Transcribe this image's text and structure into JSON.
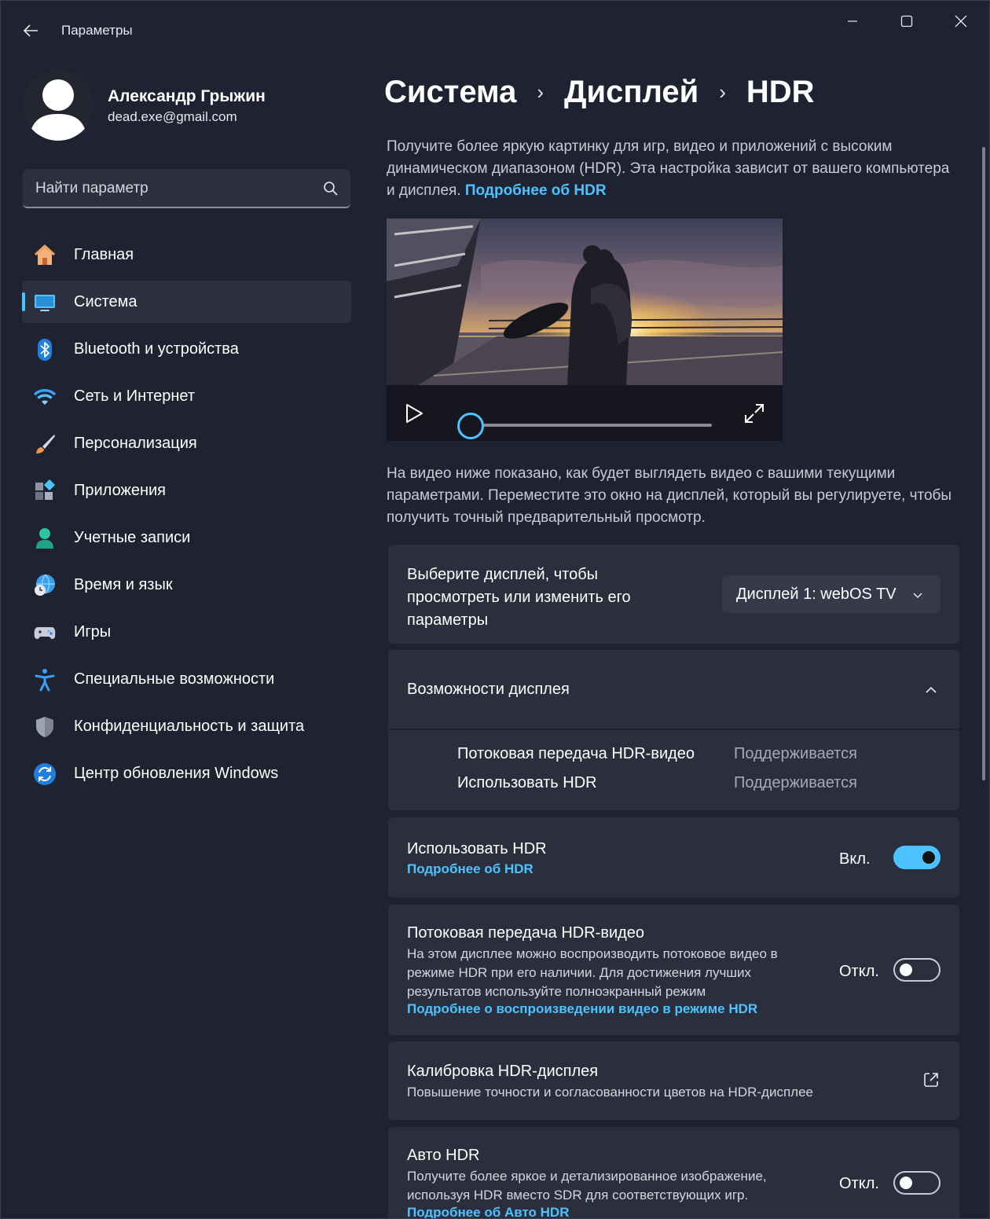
{
  "window": {
    "title": "Параметры"
  },
  "profile": {
    "name": "Александр Грыжин",
    "email": "dead.exe@gmail.com"
  },
  "search": {
    "placeholder": "Найти параметр"
  },
  "sidebar": {
    "items": [
      {
        "label": "Главная",
        "icon": "home-icon"
      },
      {
        "label": "Система",
        "icon": "system-display-icon",
        "active": true
      },
      {
        "label": "Bluetooth и устройства",
        "icon": "bluetooth-icon"
      },
      {
        "label": "Сеть и Интернет",
        "icon": "wifi-icon"
      },
      {
        "label": "Персонализация",
        "icon": "brush-icon"
      },
      {
        "label": "Приложения",
        "icon": "apps-icon"
      },
      {
        "label": "Учетные записи",
        "icon": "account-icon"
      },
      {
        "label": "Время и язык",
        "icon": "globe-clock-icon"
      },
      {
        "label": "Игры",
        "icon": "gamepad-icon"
      },
      {
        "label": "Специальные возможности",
        "icon": "accessibility-icon"
      },
      {
        "label": "Конфиденциальность и защита",
        "icon": "shield-icon"
      },
      {
        "label": "Центр обновления Windows",
        "icon": "update-icon"
      }
    ]
  },
  "breadcrumb": {
    "items": [
      "Система",
      "Дисплей",
      "HDR"
    ]
  },
  "intro": {
    "text": "Получите более яркую картинку для игр, видео и приложений с высоким динамическом диапазоном (HDR). Эта настройка зависит от вашего компьютера и дисплея.",
    "link": "Подробнее об HDR"
  },
  "video": {
    "progress": 0
  },
  "preview_note": "На видео ниже показано, как будет выглядеть видео с вашими текущими параметрами. Переместите это окно на дисплей, который вы регулируете, чтобы получить точный предварительный просмотр.",
  "display_select": {
    "label": "Выберите дисплей, чтобы просмотреть или изменить его параметры",
    "value": "Дисплей 1: webOS TV"
  },
  "capabilities": {
    "title": "Возможности дисплея",
    "rows": [
      {
        "label": "Потоковая передача HDR-видео",
        "value": "Поддерживается"
      },
      {
        "label": "Использовать HDR",
        "value": "Поддерживается"
      }
    ]
  },
  "use_hdr": {
    "title": "Использовать HDR",
    "link": "Подробнее об HDR",
    "state": "Вкл.",
    "on": true
  },
  "hdr_video": {
    "title": "Потоковая передача HDR-видео",
    "description": "На этом дисплее можно воспроизводить потоковое видео в режиме HDR при его наличии. Для достижения лучших результатов используйте полноэкранный режим",
    "link": "Подробнее о воспроизведении видео в режиме HDR",
    "state": "Откл.",
    "on": false
  },
  "calibration": {
    "title": "Калибровка HDR-дисплея",
    "description": "Повышение точности и согласованности цветов на HDR-дисплее"
  },
  "auto_hdr": {
    "title": "Авто HDR",
    "description": "Получите более яркое и детализированное изображение, используя HDR вместо SDR для соответствующих игр.",
    "link": "Подробнее об Авто HDR",
    "state": "Откл.",
    "on": false
  },
  "colors": {
    "accent": "#4cc2ff",
    "background": "#1f2231",
    "card": "#2b2e3d"
  }
}
